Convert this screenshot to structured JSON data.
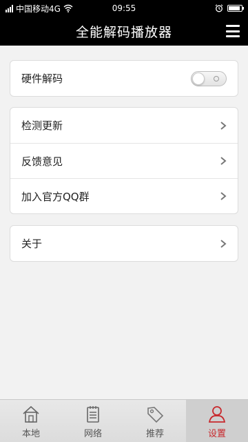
{
  "status_bar": {
    "carrier": "中国移动4G",
    "time": "09:55",
    "icons": [
      "signal-icon",
      "wifi-icon",
      "alarm-icon",
      "battery-icon"
    ]
  },
  "header": {
    "title": "全能解码播放器",
    "menu_icon": "menu-icon"
  },
  "settings": {
    "hardware_decode": {
      "label": "硬件解码",
      "toggle_on": false
    },
    "groups": [
      {
        "items": [
          {
            "label": "检测更新"
          },
          {
            "label": "反馈意见"
          },
          {
            "label": "加入官方QQ群"
          }
        ]
      },
      {
        "items": [
          {
            "label": "关于"
          }
        ]
      }
    ]
  },
  "tab_bar": {
    "tabs": [
      {
        "label": "本地",
        "icon": "home-icon",
        "active": false
      },
      {
        "label": "网络",
        "icon": "notepad-icon",
        "active": false
      },
      {
        "label": "推荐",
        "icon": "tag-icon",
        "active": false
      },
      {
        "label": "设置",
        "icon": "user-icon",
        "active": true
      }
    ]
  },
  "colors": {
    "header_bg": "#000000",
    "active_tab": "#c8282c",
    "page_bg": "#f2f2f2"
  }
}
